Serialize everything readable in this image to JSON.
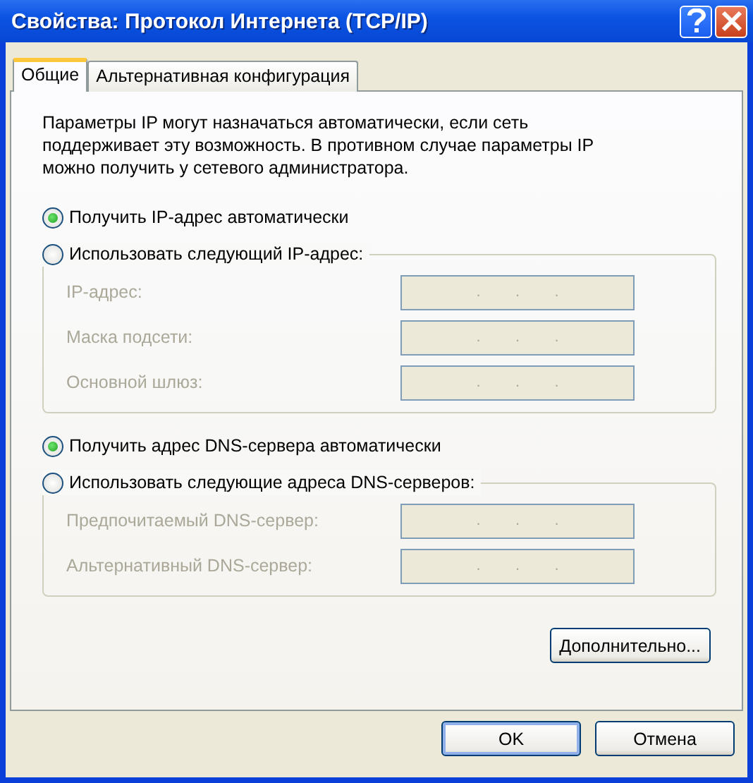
{
  "window": {
    "title": "Свойства: Протокол Интернета (TCP/IP)"
  },
  "tabs": [
    {
      "label": "Общие",
      "selected": true
    },
    {
      "label": "Альтернативная конфигурация",
      "selected": false
    }
  ],
  "description": "Параметры IP могут назначаться автоматически, если сеть поддерживает эту возможность. В противном случае параметры IP можно получить у сетевого администратора.",
  "sections": [
    {
      "auto_option": {
        "label": "Получить IP-адрес автоматически",
        "selected": true
      },
      "manual_option": {
        "label": "Использовать следующий IP-адрес:",
        "selected": false
      },
      "fields": [
        {
          "label": "IP-адрес:",
          "disabled": true,
          "separators": [
            ".",
            ".",
            "."
          ]
        },
        {
          "label": "Маска подсети:",
          "disabled": true,
          "separators": [
            ".",
            ".",
            "."
          ]
        },
        {
          "label": "Основной шлюз:",
          "disabled": true,
          "separators": [
            ".",
            ".",
            "."
          ]
        }
      ]
    },
    {
      "auto_option": {
        "label": "Получить адрес DNS-сервера автоматически",
        "selected": true
      },
      "manual_option": {
        "label": "Использовать следующие адреса DNS-серверов:",
        "selected": false
      },
      "fields": [
        {
          "label": "Предпочитаемый DNS-сервер:",
          "disabled": true,
          "separators": [
            ".",
            ".",
            "."
          ]
        },
        {
          "label": "Альтернативный DNS-сервер:",
          "disabled": true,
          "separators": [
            ".",
            ".",
            "."
          ]
        }
      ]
    }
  ],
  "advanced_button": "Дополнительно...",
  "buttons": [
    {
      "label": "OK",
      "default": true
    },
    {
      "label": "Отмена",
      "default": false
    }
  ]
}
